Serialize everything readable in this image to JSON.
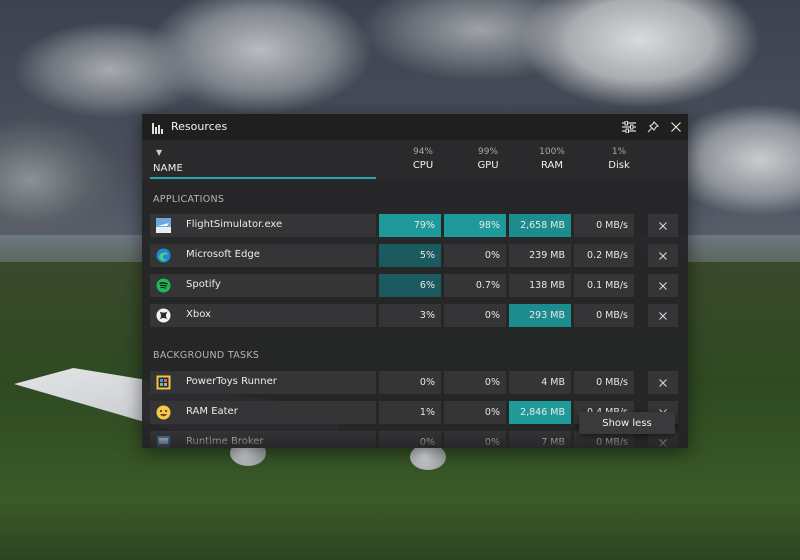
{
  "panel": {
    "title": "Resources",
    "icons": {
      "title": "bar-chart-icon",
      "settings": "sliders-icon",
      "pin": "pin-icon",
      "close": "close-icon"
    }
  },
  "columns": {
    "sort_indicator": "▼",
    "name": "NAME",
    "cpu": {
      "pct": "94%",
      "label": "CPU"
    },
    "gpu": {
      "pct": "99%",
      "label": "GPU"
    },
    "ram": {
      "pct": "100%",
      "label": "RAM"
    },
    "disk": {
      "pct": "1%",
      "label": "Disk"
    }
  },
  "sections": {
    "applications": "APPLICATIONS",
    "background": "BACKGROUND TASKS"
  },
  "applications": [
    {
      "name": "FlightSimulator.exe",
      "icon": "flight-simulator-icon",
      "cpu": "79%",
      "gpu": "98%",
      "ram": "2,658 MB",
      "disk": "0 MB/s"
    },
    {
      "name": "Microsoft Edge",
      "icon": "edge-icon",
      "cpu": "5%",
      "gpu": "0%",
      "ram": "239 MB",
      "disk": "0.2 MB/s"
    },
    {
      "name": "Spotify",
      "icon": "spotify-icon",
      "cpu": "6%",
      "gpu": "0.7%",
      "ram": "138 MB",
      "disk": "0.1 MB/s"
    },
    {
      "name": "Xbox",
      "icon": "xbox-icon",
      "cpu": "3%",
      "gpu": "0%",
      "ram": "293 MB",
      "disk": "0 MB/s"
    }
  ],
  "background_tasks": [
    {
      "name": "PowerToys Runner",
      "icon": "powertoys-icon",
      "cpu": "0%",
      "gpu": "0%",
      "ram": "4 MB",
      "disk": "0 MB/s"
    },
    {
      "name": "RAM Eater",
      "icon": "smiley-icon",
      "cpu": "1%",
      "gpu": "0%",
      "ram": "2,846 MB",
      "disk": "0.4 MB/s"
    },
    {
      "name": "Runtime Broker",
      "icon": "runtime-broker-icon",
      "cpu": "0%",
      "gpu": "0%",
      "ram": "7 MB",
      "disk": "0 MB/s"
    }
  ],
  "tooltip": {
    "show_less": "Show less"
  },
  "colors": {
    "accent": "#2aa5a5",
    "highlight_strong": "#1d8c8e",
    "highlight_soft": "#1b5a5e"
  }
}
